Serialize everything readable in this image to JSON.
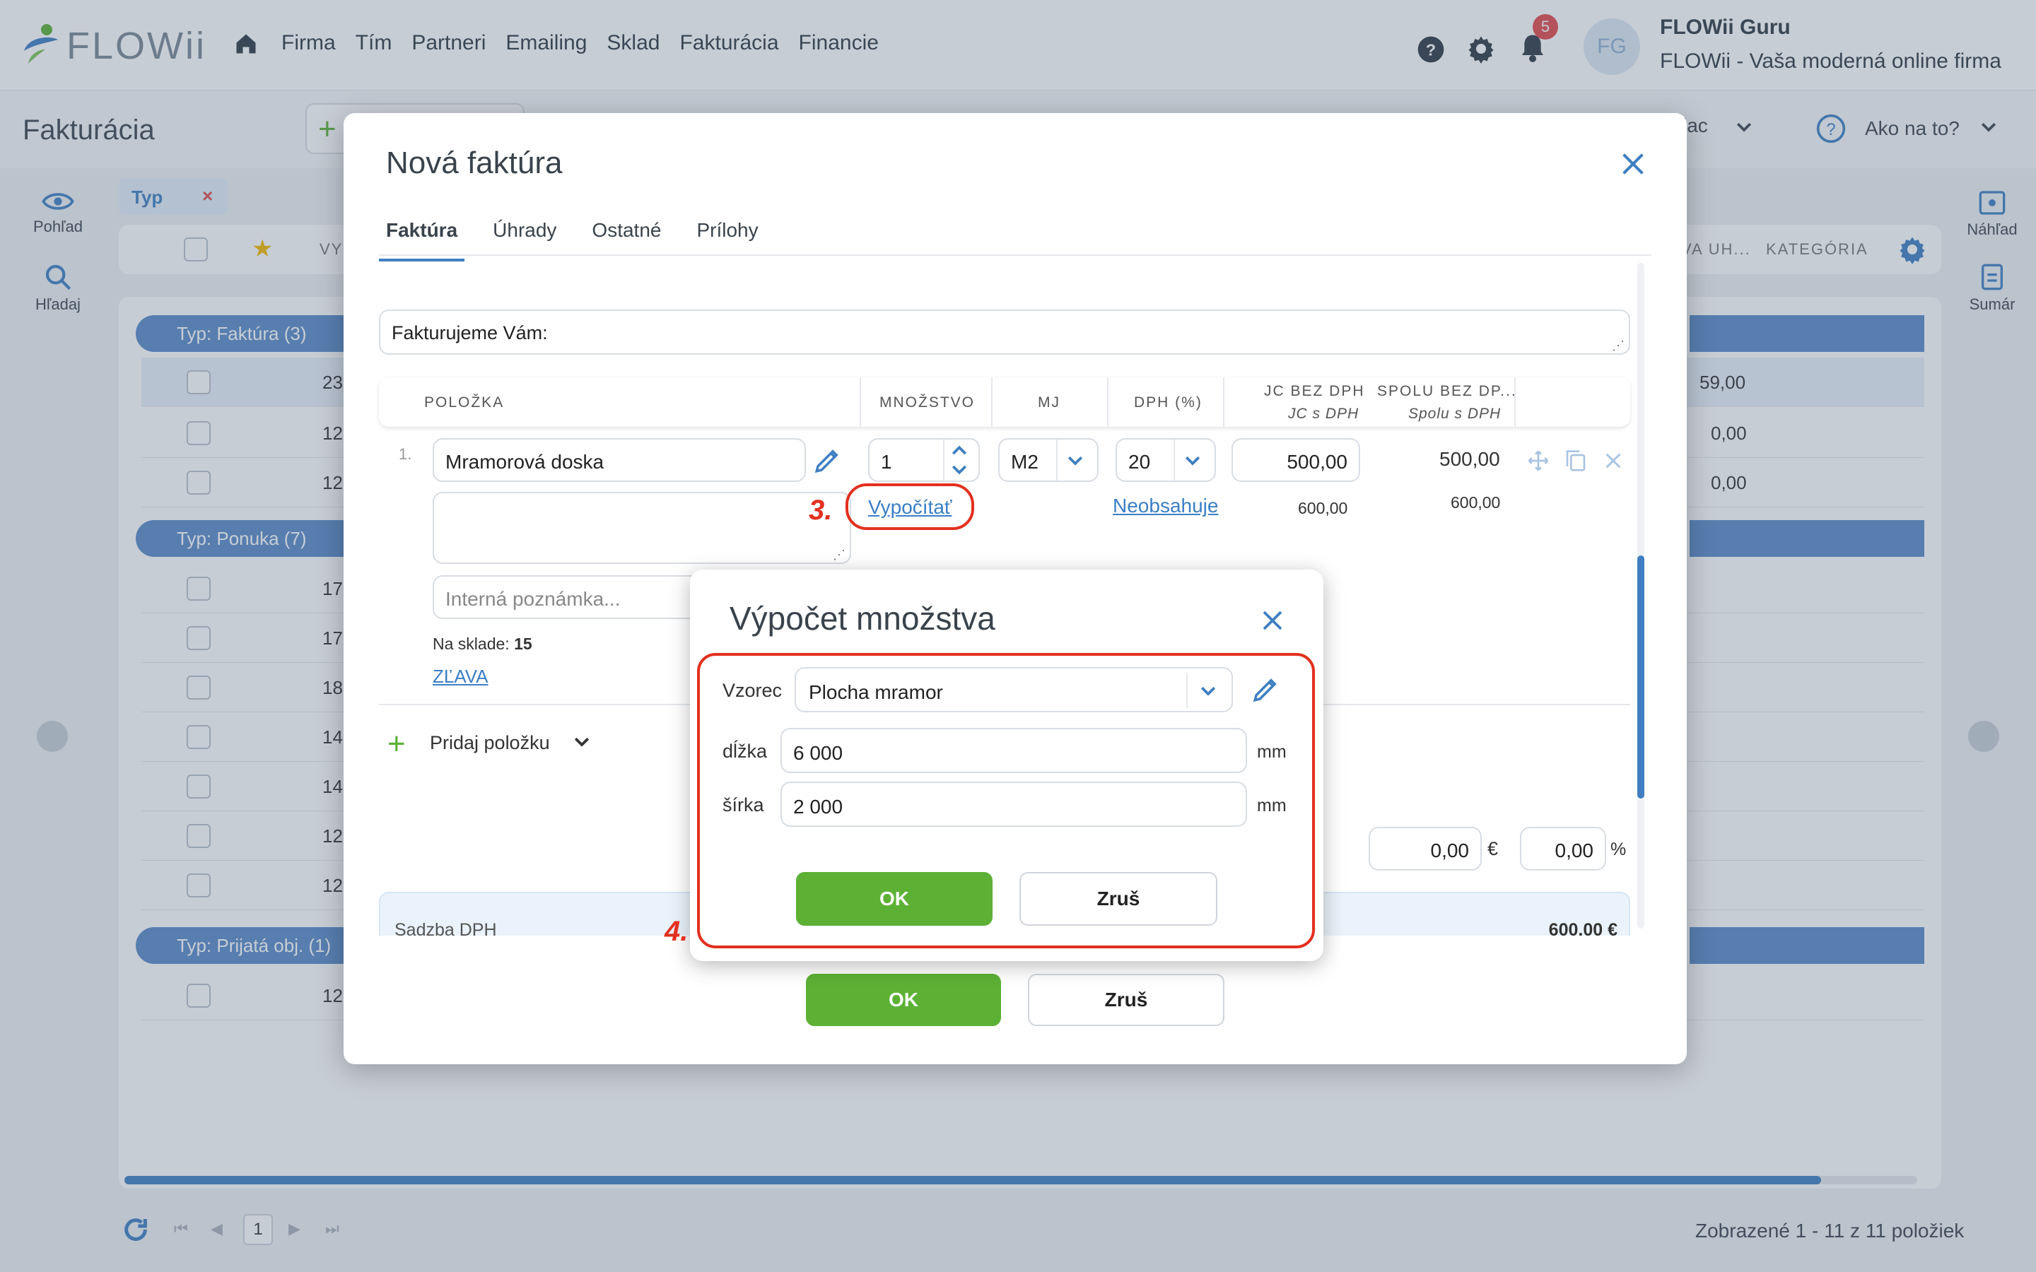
{
  "app": {
    "logo": "FLOWii",
    "nav": [
      "Firma",
      "Tím",
      "Partneri",
      "Emailing",
      "Sklad",
      "Fakturácia",
      "Financie"
    ],
    "notifications": "5",
    "avatar": "FG",
    "user_name": "FLOWii Guru",
    "user_company": "FLOWii - Vaša moderná online firma"
  },
  "page": {
    "title": "Fakturácia",
    "header_right_partial": "iac",
    "help": "Ako na to?",
    "left_sidebar": [
      {
        "label": "Pohľad",
        "icon": "eye-icon"
      },
      {
        "label": "Hľadaj",
        "icon": "search-icon"
      }
    ],
    "right_sidebar": [
      {
        "label": "Náhľad",
        "icon": "preview-icon"
      },
      {
        "label": "Sumár",
        "icon": "summary-icon"
      }
    ],
    "filter_chip": "Typ",
    "columns_partial": {
      "left": "VYS",
      "mid": "VA UH...",
      "right": "KATEGÓRIA"
    },
    "groups": [
      {
        "label": "Typ: Faktúra (3)",
        "rows": [
          {
            "id": "23",
            "amount": "59,00"
          },
          {
            "id": "12.",
            "amount": "0,00"
          },
          {
            "id": "12.",
            "amount": "0,00"
          }
        ]
      },
      {
        "label": "Typ: Ponuka (7)",
        "rows": [
          {
            "id": "17."
          },
          {
            "id": "17."
          },
          {
            "id": "18."
          },
          {
            "id": "14."
          },
          {
            "id": "14."
          },
          {
            "id": "12."
          },
          {
            "id": "12."
          }
        ]
      },
      {
        "label": "Typ: Prijatá obj. (1)",
        "rows": [
          {
            "id": "12."
          }
        ]
      }
    ],
    "pagination": {
      "page": "1",
      "summary": "Zobrazené 1 - 11 z 11 položiek"
    }
  },
  "invoice_modal": {
    "title": "Nová faktúra",
    "tabs": [
      "Faktúra",
      "Úhrady",
      "Ostatné",
      "Prílohy"
    ],
    "intro_placeholder": "Fakturujeme Vám:",
    "columns": {
      "item": "POLOŽKA",
      "qty": "MNOŽSTVO",
      "unit": "MJ",
      "vat": "DPH (%)",
      "unit_price": "JC BEZ DPH",
      "unit_price_vat": "JC s DPH",
      "total": "SPOLU BEZ DP...",
      "total_vat": "Spolu s DPH"
    },
    "line": {
      "index": "1.",
      "name": "Mramorová doska",
      "qty": "1",
      "unit": "M2",
      "vat": "20",
      "unit_price": "500,00",
      "total": "500,00",
      "unit_price_vat": "600,00",
      "total_vat": "600,00",
      "calc_link": "Vypočítať",
      "vat_link": "Neobsahuje",
      "note_placeholder": "Interná poznámka...",
      "stock_label": "Na sklade:",
      "stock_value": "15",
      "discount_link": "ZĽAVA"
    },
    "add_item": "Pridaj položku",
    "discount_amount": "0,00",
    "currency": "€",
    "discount_percent": "0,00",
    "percent_sign": "%",
    "vat_rate_label": "Sadzba DPH",
    "total": "600,00 €",
    "ok": "OK",
    "cancel": "Zruš"
  },
  "annotations": {
    "step3": "3.",
    "step4": "4."
  },
  "calc_popup": {
    "title": "Výpočet množstva",
    "formula_label": "Vzorec",
    "formula_value": "Plocha mramor",
    "fields": [
      {
        "label": "dĺžka",
        "value": "6 000",
        "unit": "mm"
      },
      {
        "label": "šírka",
        "value": "2 000",
        "unit": "mm"
      }
    ],
    "ok": "OK",
    "cancel": "Zruš"
  },
  "colors": {
    "accent": "#3f7fc1",
    "ok_green": "#5cb135",
    "annotation_red": "#e3301f",
    "group_blue": "#5a8bc8"
  }
}
